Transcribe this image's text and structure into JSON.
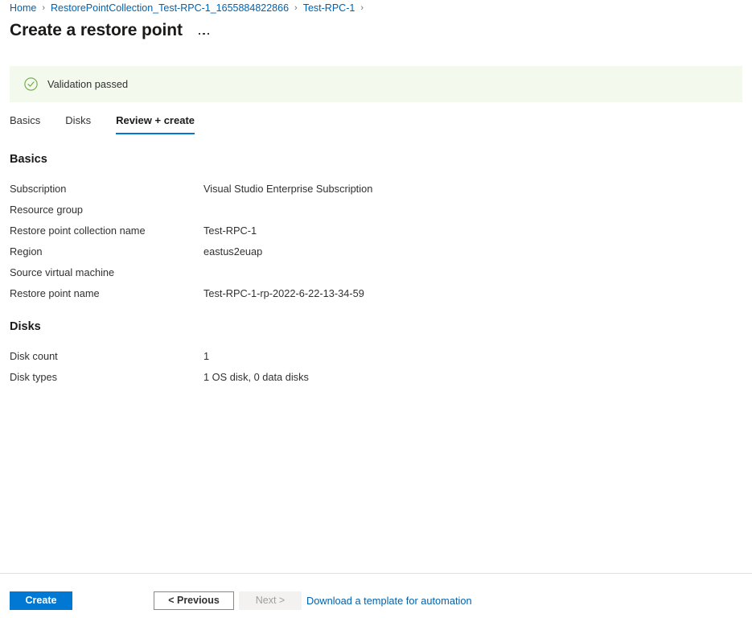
{
  "breadcrumb": {
    "separator": "›",
    "items": [
      {
        "label": "Home"
      },
      {
        "label": "RestorePointCollection_Test-RPC-1_1655884822866"
      },
      {
        "label": "Test-RPC-1"
      }
    ],
    "trailing_separator": "›"
  },
  "header": {
    "title": "Create a restore point",
    "more_menu": "..."
  },
  "validation": {
    "icon": "check-circle-icon",
    "message": "Validation passed",
    "background_color": "#f3f9ed",
    "icon_color": "#67a73f"
  },
  "tabs": [
    {
      "label": "Basics",
      "active": false
    },
    {
      "label": "Disks",
      "active": false
    },
    {
      "label": "Review + create",
      "active": true
    }
  ],
  "sections": [
    {
      "heading": "Basics",
      "rows": [
        {
          "label": "Subscription",
          "value": "Visual Studio Enterprise Subscription"
        },
        {
          "label": "Resource group",
          "value": ""
        },
        {
          "label": "Restore point collection name",
          "value": "Test-RPC-1"
        },
        {
          "label": "Region",
          "value": "eastus2euap"
        },
        {
          "label": "Source virtual machine",
          "value": ""
        },
        {
          "label": "Restore point name",
          "value": "Test-RPC-1-rp-2022-6-22-13-34-59"
        }
      ]
    },
    {
      "heading": "Disks",
      "rows": [
        {
          "label": "Disk count",
          "value": "1"
        },
        {
          "label": "Disk types",
          "value": "1 OS disk, 0 data disks"
        }
      ]
    }
  ],
  "footer": {
    "create_label": "Create",
    "previous_label": "< Previous",
    "next_label": "Next >",
    "next_disabled": true,
    "template_link_label": "Download a template for automation"
  },
  "colors": {
    "accent_blue": "#0078d4",
    "link_blue": "#0062ad",
    "text_primary": "#323130",
    "text_heading": "#1b1a19",
    "success_green": "#67a73f",
    "divider": "#e1dfdd"
  }
}
